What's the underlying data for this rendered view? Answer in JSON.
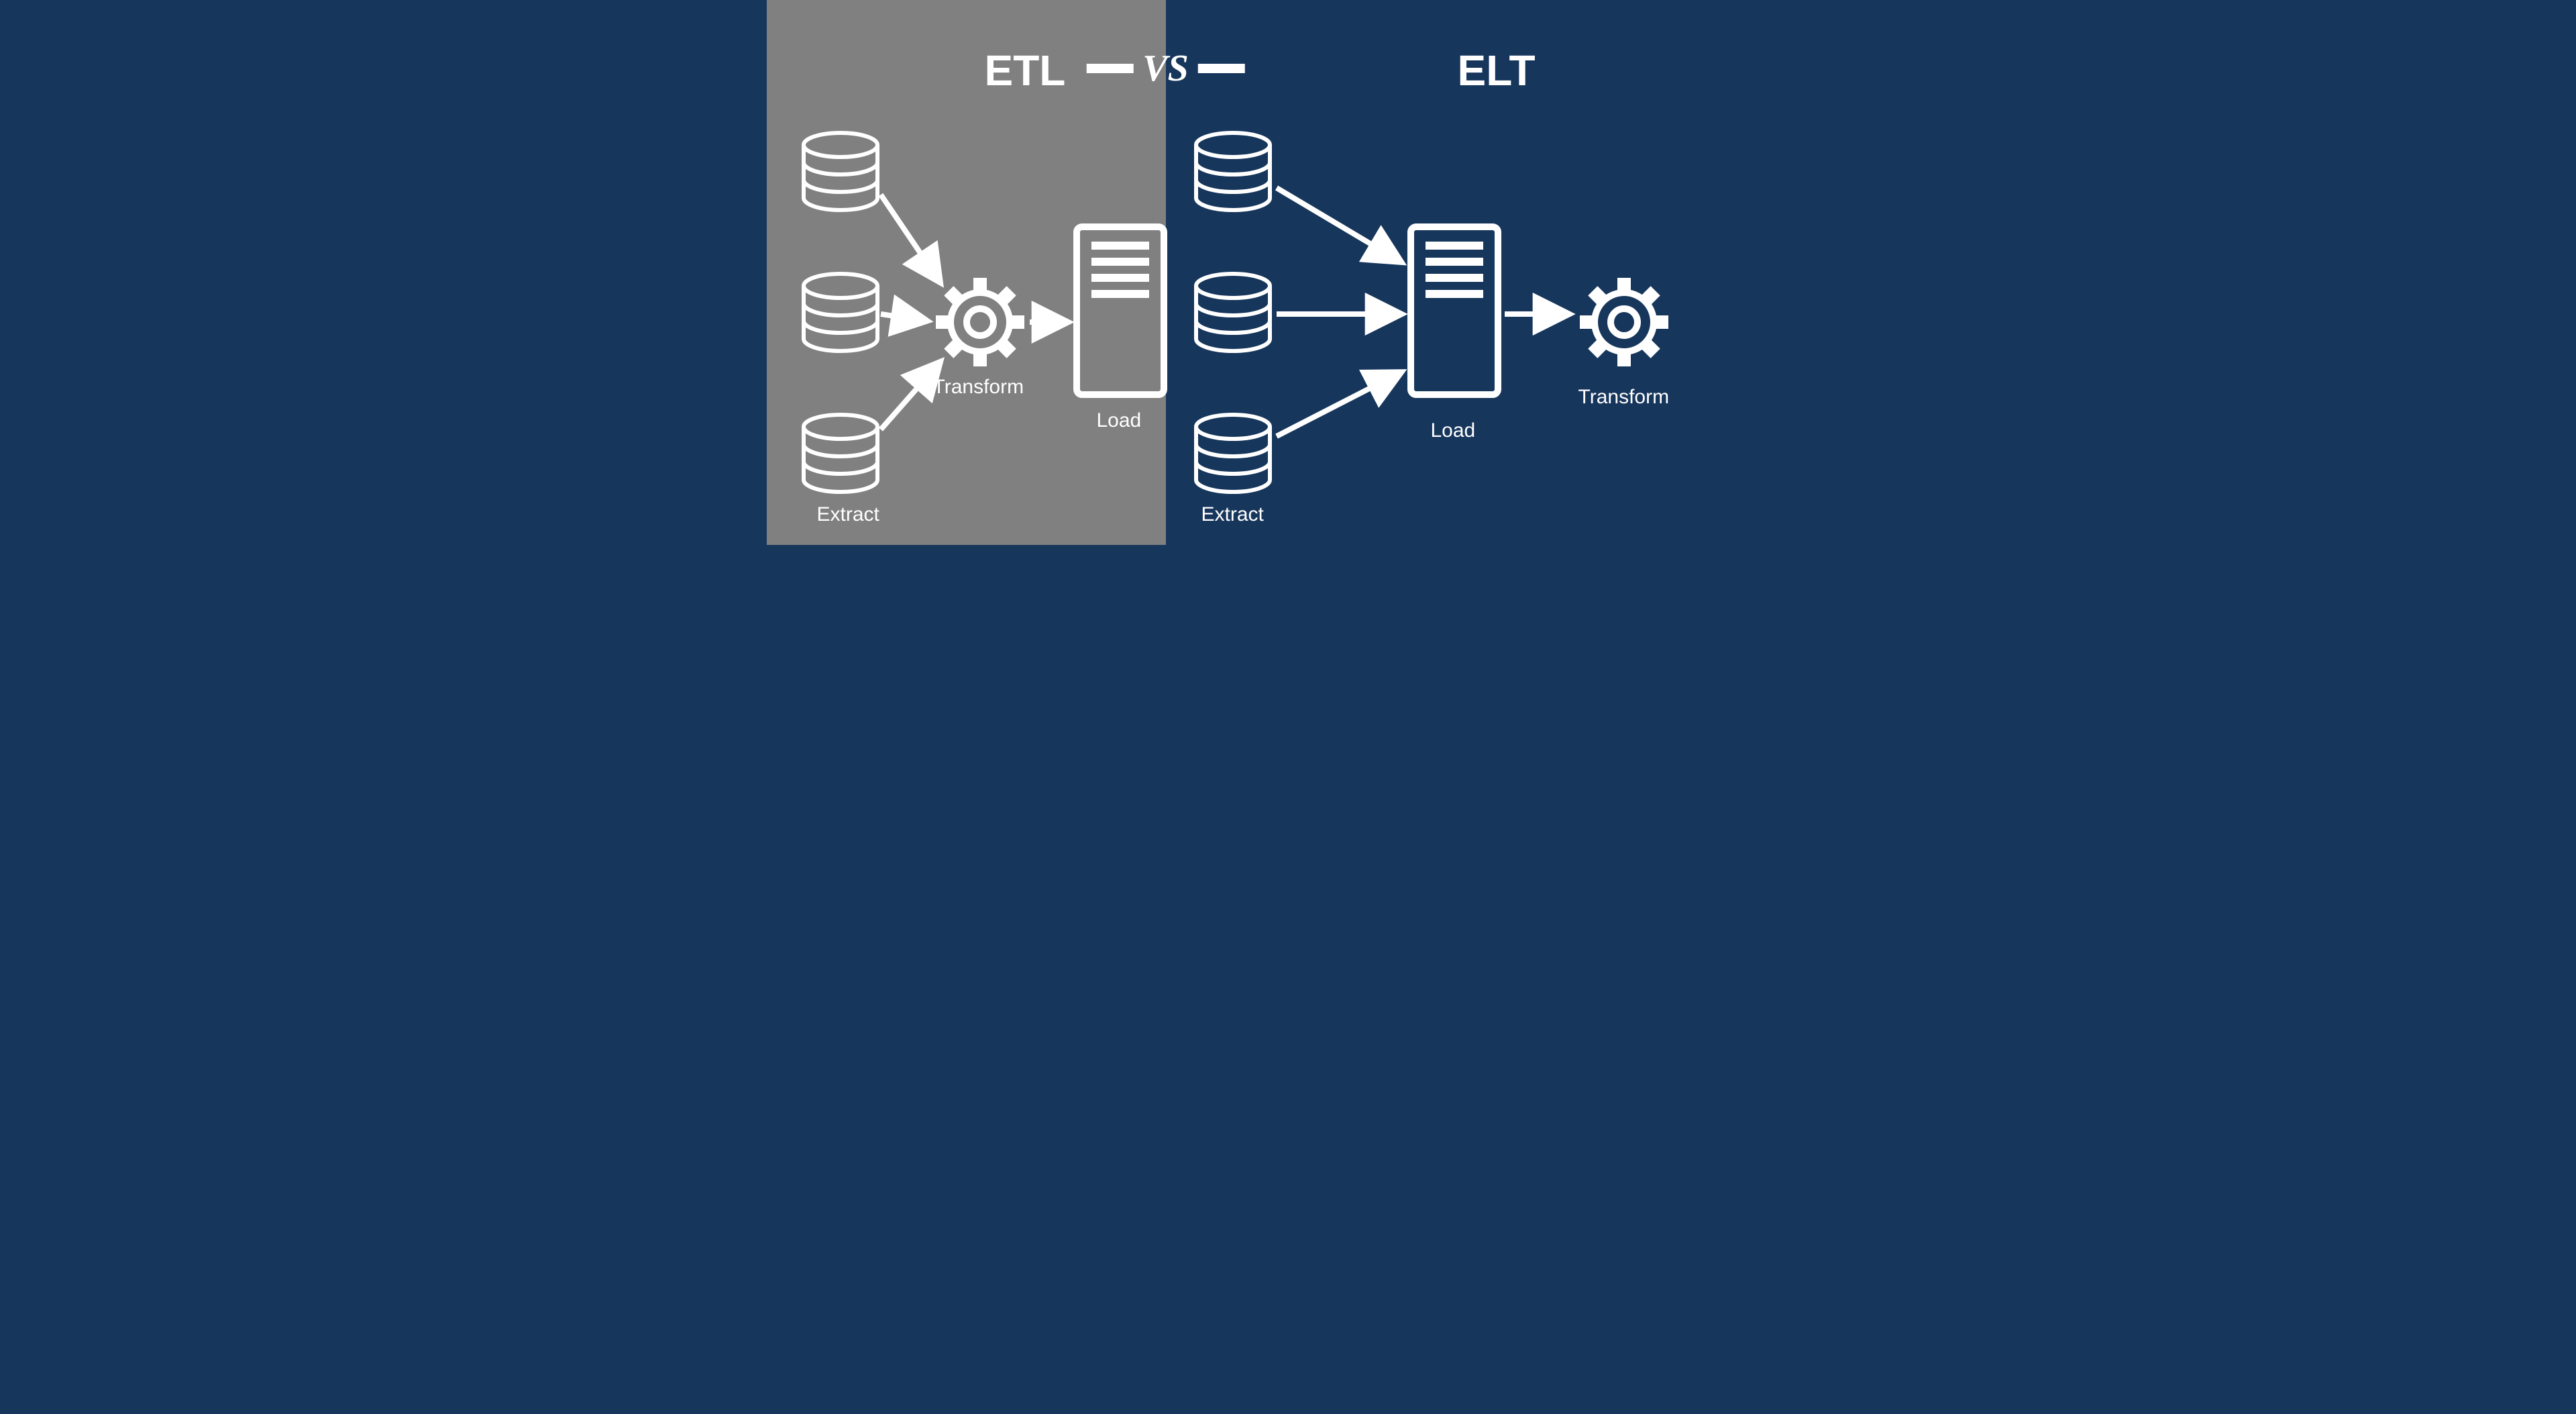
{
  "titles": {
    "left": "ETL",
    "right": "ELT",
    "vs": "VS"
  },
  "left": {
    "extract_label": "Extract",
    "transform_label": "Transform",
    "load_label": "Load"
  },
  "right": {
    "extract_label": "Extract",
    "load_label": "Load",
    "transform_label": "Transform"
  },
  "colors": {
    "panel_left": "#808080",
    "panel_right": "#17365c",
    "stroke": "#ffffff"
  },
  "diagram": {
    "left_flow": [
      "Extract",
      "Transform",
      "Load"
    ],
    "right_flow": [
      "Extract",
      "Load",
      "Transform"
    ],
    "sources_count": 3
  }
}
